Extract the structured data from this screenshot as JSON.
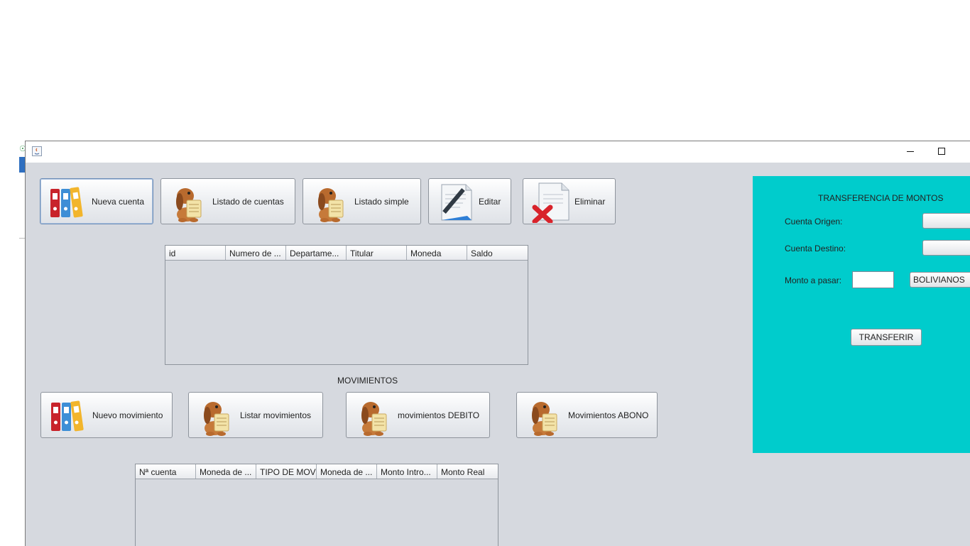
{
  "window": {
    "title": ""
  },
  "accounts_toolbar": {
    "new_account": "Nueva cuenta",
    "account_list": "Listado de cuentas",
    "simple_list": "Listado simple",
    "edit": "Editar",
    "delete": "Eliminar"
  },
  "accounts_table": {
    "columns": [
      "id",
      "Numero de ...",
      "Departame...",
      "Titular",
      "Moneda",
      "Saldo"
    ],
    "rows": []
  },
  "movements": {
    "section_title": "MOVIMIENTOS",
    "new_movement": "Nuevo movimiento",
    "list_movements": "Listar movimientos",
    "debit_movements": "movimientos DEBITO",
    "credit_movements": "Movimientos ABONO"
  },
  "movements_table": {
    "columns": [
      "Nª cuenta",
      "Moneda de ...",
      "TIPO DE MOV",
      "Moneda de ...",
      "Monto Intro...",
      "Monto Real"
    ],
    "rows": []
  },
  "transfer": {
    "title": "TRANSFERENCIA DE MONTOS",
    "origin_label": "Cuenta Origen:",
    "origin_value": "",
    "destination_label": "Cuenta Destino:",
    "destination_value": "",
    "amount_label": "Monto a pasar:",
    "amount_value": "",
    "currency": "BOLIVIANOS",
    "submit": "TRANSFERIR",
    "panel_color": "#00cccc"
  },
  "icons": {
    "new_account": "binders-icon",
    "account_list": "dog-with-scroll-icon",
    "edit": "pen-document-icon",
    "delete": "red-x-document-icon"
  }
}
